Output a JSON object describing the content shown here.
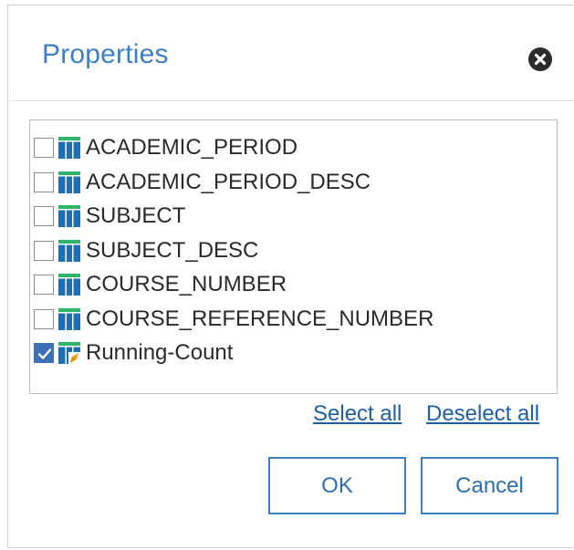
{
  "dialog": {
    "title": "Properties",
    "close_icon": "close-circle-icon"
  },
  "items": [
    {
      "label": "ACADEMIC_PERIOD",
      "checked": false,
      "icon": "data-column-icon"
    },
    {
      "label": "ACADEMIC_PERIOD_DESC",
      "checked": false,
      "icon": "data-column-icon"
    },
    {
      "label": "SUBJECT",
      "checked": false,
      "icon": "data-column-icon"
    },
    {
      "label": "SUBJECT_DESC",
      "checked": false,
      "icon": "data-column-icon"
    },
    {
      "label": "COURSE_NUMBER",
      "checked": false,
      "icon": "data-column-icon"
    },
    {
      "label": "COURSE_REFERENCE_NUMBER",
      "checked": false,
      "icon": "data-column-icon"
    },
    {
      "label": "Running-Count",
      "checked": true,
      "icon": "calculated-column-icon"
    }
  ],
  "links": {
    "select_all": "Select all",
    "deselect_all": "Deselect all"
  },
  "buttons": {
    "ok": "OK",
    "cancel": "Cancel"
  },
  "colors": {
    "accent": "#3d7fc1",
    "check": "#3d6fb6",
    "column_header": "#2fb56a",
    "column_body": "#1f6fb5",
    "calc_badge": "#f0a418"
  }
}
